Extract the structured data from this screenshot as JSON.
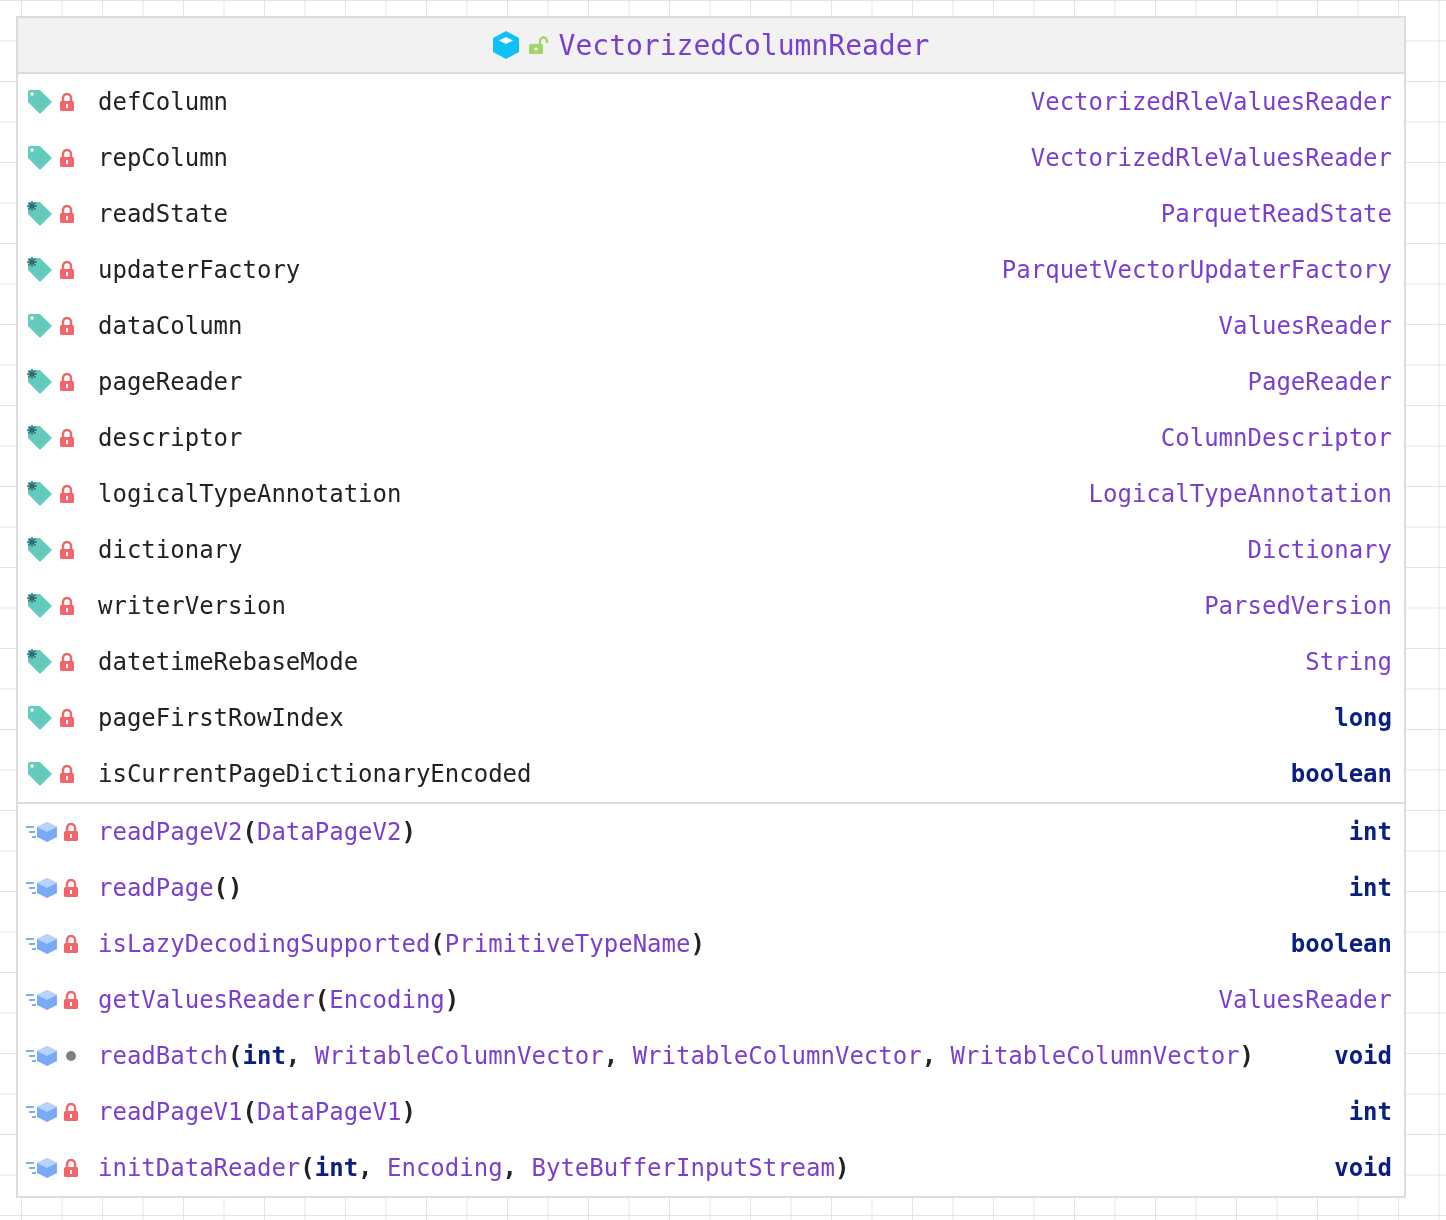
{
  "class": {
    "name": "VectorizedColumnReader",
    "private": false
  },
  "fields": [
    {
      "name": "defColumn",
      "final": false,
      "private": true,
      "type": {
        "text": "VectorizedRleValuesReader",
        "kind": "class"
      }
    },
    {
      "name": "repColumn",
      "final": false,
      "private": true,
      "type": {
        "text": "VectorizedRleValuesReader",
        "kind": "class"
      }
    },
    {
      "name": "readState",
      "final": true,
      "private": true,
      "type": {
        "text": "ParquetReadState",
        "kind": "class"
      }
    },
    {
      "name": "updaterFactory",
      "final": true,
      "private": true,
      "type": {
        "text": "ParquetVectorUpdaterFactory",
        "kind": "class"
      }
    },
    {
      "name": "dataColumn",
      "final": false,
      "private": true,
      "type": {
        "text": "ValuesReader",
        "kind": "class"
      }
    },
    {
      "name": "pageReader",
      "final": true,
      "private": true,
      "type": {
        "text": "PageReader",
        "kind": "class"
      }
    },
    {
      "name": "descriptor",
      "final": true,
      "private": true,
      "type": {
        "text": "ColumnDescriptor",
        "kind": "class"
      }
    },
    {
      "name": "logicalTypeAnnotation",
      "final": true,
      "private": true,
      "type": {
        "text": "LogicalTypeAnnotation",
        "kind": "class"
      }
    },
    {
      "name": "dictionary",
      "final": true,
      "private": true,
      "type": {
        "text": "Dictionary",
        "kind": "class"
      }
    },
    {
      "name": "writerVersion",
      "final": true,
      "private": true,
      "type": {
        "text": "ParsedVersion",
        "kind": "class"
      }
    },
    {
      "name": "datetimeRebaseMode",
      "final": true,
      "private": true,
      "type": {
        "text": "String",
        "kind": "class"
      }
    },
    {
      "name": "pageFirstRowIndex",
      "final": false,
      "private": true,
      "type": {
        "text": "long",
        "kind": "primitive"
      }
    },
    {
      "name": "isCurrentPageDictionaryEncoded",
      "final": false,
      "private": true,
      "type": {
        "text": "boolean",
        "kind": "primitive"
      }
    }
  ],
  "methods": [
    {
      "name": "readPageV2",
      "private": true,
      "signature": [
        {
          "text": "(",
          "kind": "punct"
        },
        {
          "text": "DataPageV2",
          "kind": "class"
        },
        {
          "text": ")",
          "kind": "punct"
        }
      ],
      "returns": {
        "text": "int",
        "kind": "primitive"
      }
    },
    {
      "name": "readPage",
      "private": true,
      "signature": [
        {
          "text": "()",
          "kind": "punct"
        }
      ],
      "returns": {
        "text": "int",
        "kind": "primitive"
      }
    },
    {
      "name": "isLazyDecodingSupported",
      "private": true,
      "signature": [
        {
          "text": "(",
          "kind": "punct"
        },
        {
          "text": "PrimitiveTypeName",
          "kind": "class"
        },
        {
          "text": ")",
          "kind": "punct"
        }
      ],
      "returns": {
        "text": "boolean",
        "kind": "primitive"
      }
    },
    {
      "name": "getValuesReader",
      "private": true,
      "signature": [
        {
          "text": "(",
          "kind": "punct"
        },
        {
          "text": "Encoding",
          "kind": "class"
        },
        {
          "text": ")",
          "kind": "punct"
        }
      ],
      "returns": {
        "text": "ValuesReader",
        "kind": "class"
      }
    },
    {
      "name": "readBatch",
      "private": false,
      "signature": [
        {
          "text": "(",
          "kind": "punct"
        },
        {
          "text": "int",
          "kind": "primitive"
        },
        {
          "text": ", ",
          "kind": "punct"
        },
        {
          "text": "WritableColumnVector",
          "kind": "class"
        },
        {
          "text": ", ",
          "kind": "punct"
        },
        {
          "text": "WritableColumnVector",
          "kind": "class"
        },
        {
          "text": ", ",
          "kind": "punct"
        },
        {
          "text": "WritableColumnVector",
          "kind": "class"
        },
        {
          "text": ")",
          "kind": "punct"
        }
      ],
      "returns": {
        "text": "void",
        "kind": "primitive"
      }
    },
    {
      "name": "readPageV1",
      "private": true,
      "signature": [
        {
          "text": "(",
          "kind": "punct"
        },
        {
          "text": "DataPageV1",
          "kind": "class"
        },
        {
          "text": ")",
          "kind": "punct"
        }
      ],
      "returns": {
        "text": "int",
        "kind": "primitive"
      }
    },
    {
      "name": "initDataReader",
      "private": true,
      "signature": [
        {
          "text": "(",
          "kind": "punct"
        },
        {
          "text": "int",
          "kind": "primitive"
        },
        {
          "text": ", ",
          "kind": "punct"
        },
        {
          "text": "Encoding",
          "kind": "class"
        },
        {
          "text": ", ",
          "kind": "punct"
        },
        {
          "text": "ByteBufferInputStream",
          "kind": "class"
        },
        {
          "text": ")",
          "kind": "punct"
        }
      ],
      "returns": {
        "text": "void",
        "kind": "primitive"
      }
    }
  ]
}
